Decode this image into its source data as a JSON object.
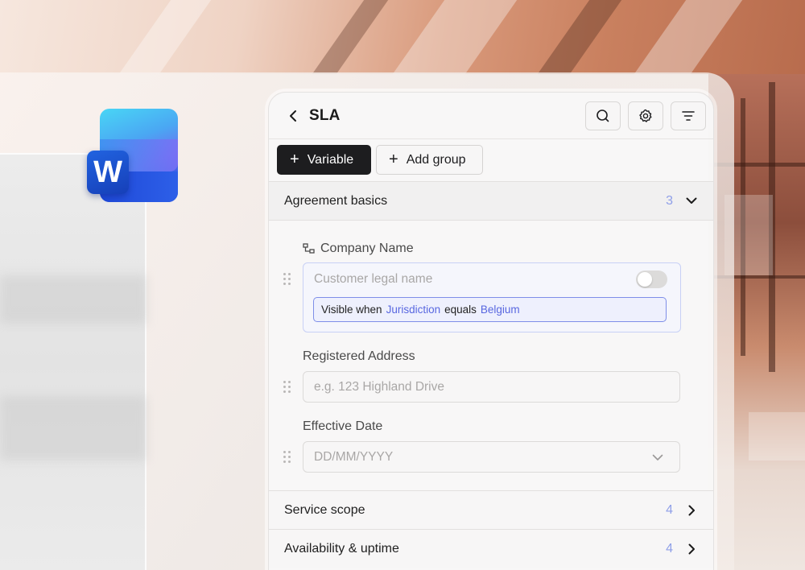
{
  "panel": {
    "title": "SLA",
    "header_icons": [
      "search-icon",
      "gear-icon",
      "filter-icon"
    ]
  },
  "toolbar": {
    "variable_label": "Variable",
    "add_group_label": "Add group"
  },
  "groups": [
    {
      "label": "Agreement basics",
      "count": "3",
      "expanded": true
    },
    {
      "label": "Service scope",
      "count": "4",
      "expanded": false
    },
    {
      "label": "Availability & uptime",
      "count": "4",
      "expanded": false
    }
  ],
  "fields": {
    "company_name": {
      "label": "Company Name",
      "placeholder": "Customer legal name",
      "toggle_on": false,
      "condition": {
        "prefix": "Visible when",
        "variable": "Jurisdiction",
        "operator": "equals",
        "value": "Belgium"
      }
    },
    "registered_address": {
      "label": "Registered Address",
      "placeholder": "e.g. 123 Highland Drive"
    },
    "effective_date": {
      "label": "Effective Date",
      "placeholder": "DD/MM/YYYY"
    }
  },
  "colors": {
    "accent": "#5867e0",
    "count": "#8f9fe8",
    "primary_button": "#1d1d1f"
  }
}
